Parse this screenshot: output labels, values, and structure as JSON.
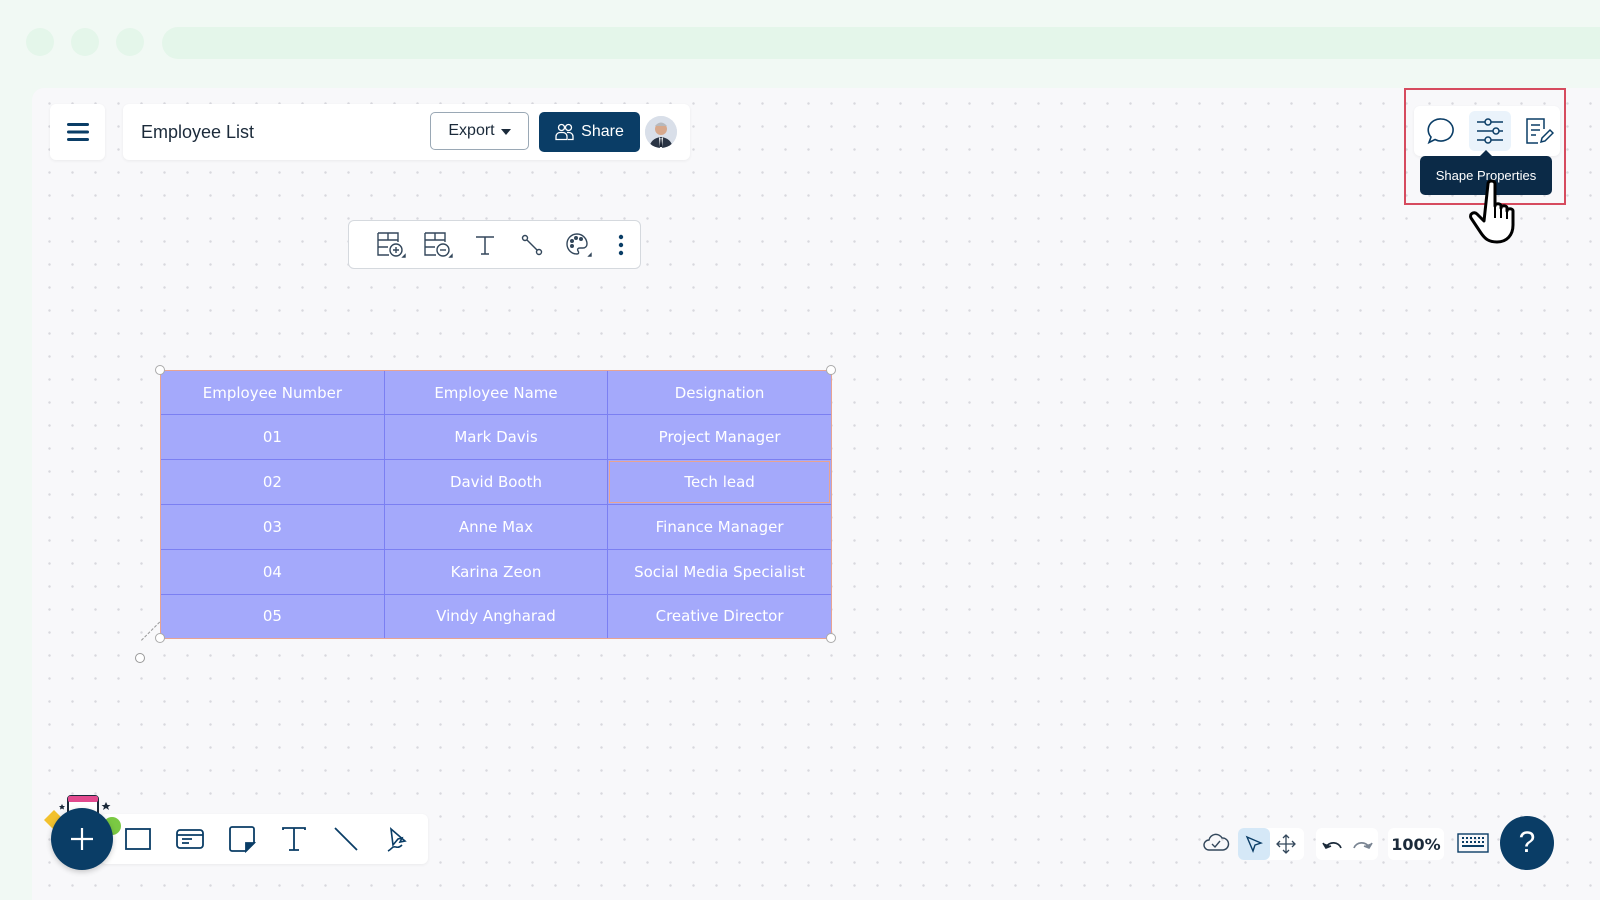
{
  "app": {
    "document_title": "Employee List",
    "export_label": "Export",
    "share_label": "Share",
    "avatar_alt": "user avatar"
  },
  "context_toolbar": {
    "items": [
      {
        "icon": "table-add-icon",
        "label": "Add row/column"
      },
      {
        "icon": "table-remove-icon",
        "label": "Remove row/column"
      },
      {
        "icon": "text-icon",
        "label": "Text"
      },
      {
        "icon": "connector-icon",
        "label": "Connector"
      },
      {
        "icon": "palette-icon",
        "label": "Colors"
      },
      {
        "icon": "more-vertical-icon",
        "label": "More"
      }
    ]
  },
  "right_panel": {
    "items": [
      {
        "icon": "comment-icon",
        "label": "Comments"
      },
      {
        "icon": "sliders-icon",
        "label": "Shape Properties",
        "active": true
      },
      {
        "icon": "notes-edit-icon",
        "label": "Notes"
      }
    ],
    "tooltip": "Shape Properties"
  },
  "table": {
    "headers": [
      "Employee Number",
      "Employee Name",
      "Designation"
    ],
    "rows": [
      [
        "01",
        "Mark Davis",
        "Project Manager"
      ],
      [
        "02",
        "David Booth",
        "Tech lead"
      ],
      [
        "03",
        "Anne Max",
        "Finance Manager"
      ],
      [
        "04",
        "Karina Zeon",
        "Social Media Specialist"
      ],
      [
        "05",
        "Vindy Angharad",
        "Creative Director"
      ]
    ],
    "selected_cell": "Tech lead",
    "fill_color": "#a4a9fb",
    "border_color": "#7b7ff2"
  },
  "bottom_toolbar": {
    "items": [
      "rectangle-icon",
      "card-icon",
      "sticky-note-icon",
      "text-icon",
      "line-icon",
      "pen-icon"
    ]
  },
  "bottom_right": {
    "zoom_level": "100%",
    "help_label": "?"
  },
  "colors": {
    "primary": "#0a3d66",
    "highlight": "#d64b5e",
    "tooltip_bg": "#0b2a47"
  }
}
